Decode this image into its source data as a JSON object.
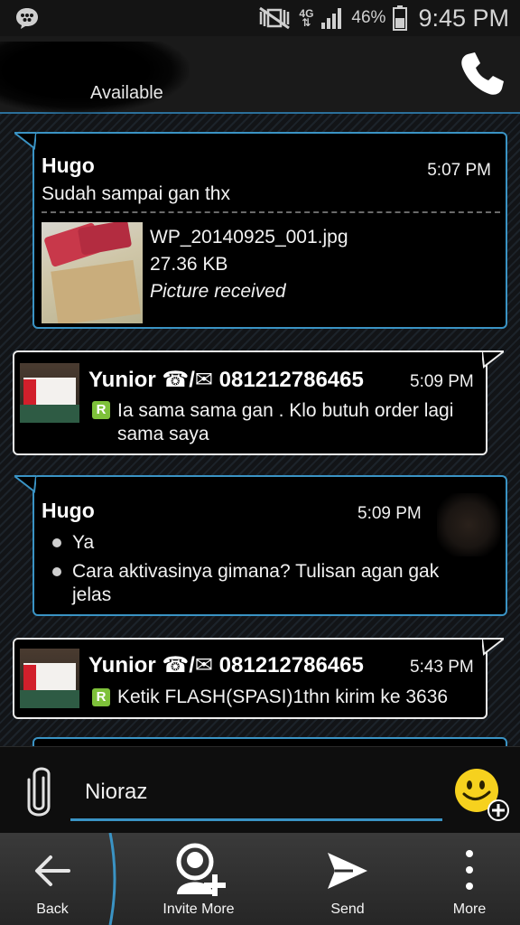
{
  "status_bar": {
    "network_type": "4G",
    "battery_percent": "46%",
    "time": "9:45 PM"
  },
  "header": {
    "status": "Available"
  },
  "messages": [
    {
      "sender": "Hugo",
      "time": "5:07 PM",
      "text": "Sudah sampai gan thx",
      "attachment": {
        "filename": "WP_20140925_001.jpg",
        "size": "27.36 KB",
        "status": "Picture received"
      }
    },
    {
      "sender": "Yunior ☎/✉ 081212786465",
      "time": "5:09 PM",
      "status_badge": "R",
      "lines": [
        "Ia sama sama gan . Klo butuh order lagi",
        "sama saya"
      ]
    },
    {
      "sender": "Hugo",
      "time": "5:09 PM",
      "bullets": [
        "Ya",
        "Cara aktivasinya gimana? Tulisan agan gak",
        "jelas"
      ]
    },
    {
      "sender": "Yunior ☎/✉ 081212786465",
      "time": "5:43 PM",
      "status_badge": "R",
      "text": "Ketik FLASH(SPASI)1thn kirim ke 3636"
    }
  ],
  "composer": {
    "value": "Nioraz"
  },
  "actions": {
    "back": "Back",
    "invite_more": "Invite More",
    "send": "Send",
    "more": "More"
  },
  "colors": {
    "accent": "#3a93c4",
    "badge_green": "#7ec13a",
    "emoji_yellow": "#f6d11e"
  }
}
